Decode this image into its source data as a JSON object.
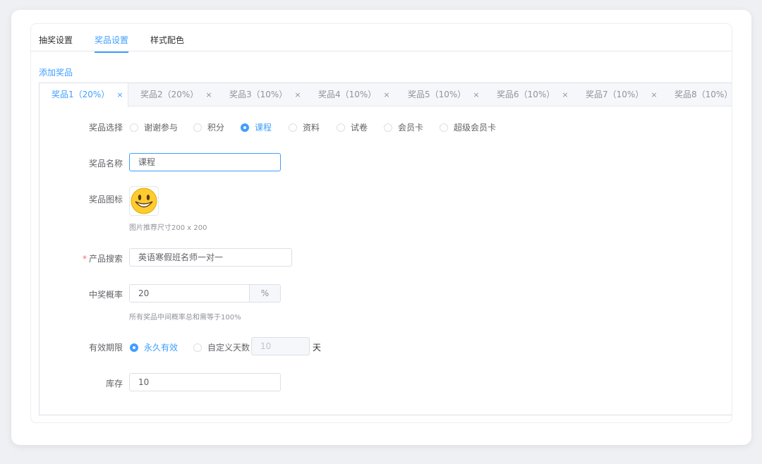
{
  "top_tabs": [
    {
      "label": "抽奖设置"
    },
    {
      "label": "奖品设置"
    },
    {
      "label": "样式配色"
    }
  ],
  "add_prize_label": "添加奖品",
  "prize_tabs": [
    {
      "label": "奖品1（20%）"
    },
    {
      "label": "奖品2（20%）"
    },
    {
      "label": "奖品3（10%）"
    },
    {
      "label": "奖品4（10%）"
    },
    {
      "label": "奖品5（10%）"
    },
    {
      "label": "奖品6（10%）"
    },
    {
      "label": "奖品7（10%）"
    },
    {
      "label": "奖品8（10%）"
    }
  ],
  "close_glyph": "×",
  "form": {
    "prize_type": {
      "label": "奖品选择",
      "options": [
        "谢谢参与",
        "积分",
        "课程",
        "资料",
        "试卷",
        "会员卡",
        "超级会员卡"
      ],
      "selected": "课程"
    },
    "prize_name": {
      "label": "奖品名称",
      "value": "课程"
    },
    "prize_icon": {
      "label": "奖品图标",
      "hint": "图片推荐尺寸200 x 200",
      "icon": "smiley-face-icon"
    },
    "product_search": {
      "label": "产品搜索",
      "required_mark": "*",
      "value": "英语寒假班名师一对一"
    },
    "win_rate": {
      "label": "中奖概率",
      "value": "20",
      "unit": "%",
      "hint": "所有奖品中间概率总和需等于100%"
    },
    "validity": {
      "label": "有效期限",
      "options": [
        "永久有效",
        "自定义天数"
      ],
      "selected": "永久有效",
      "days_value": "10",
      "days_unit": "天"
    },
    "stock": {
      "label": "库存",
      "value": "10"
    }
  },
  "colors": {
    "accent": "#409eff",
    "required": "#f56c6c"
  }
}
